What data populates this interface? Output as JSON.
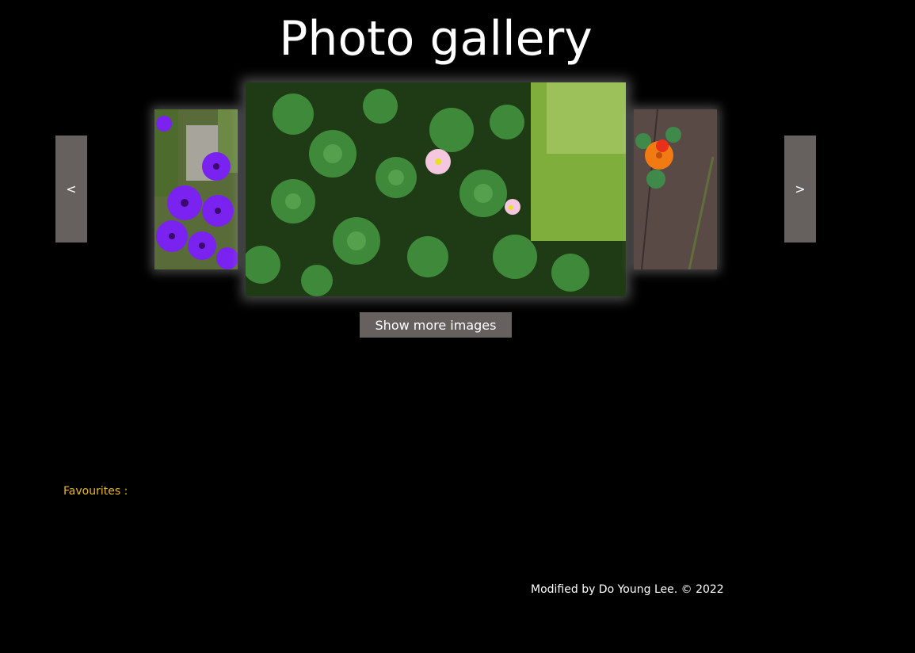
{
  "header": {
    "title": "Photo gallery"
  },
  "carousel": {
    "prev_label": "<",
    "next_label": ">",
    "photos": [
      {
        "position": "left",
        "subject": "purple-flowers"
      },
      {
        "position": "center",
        "subject": "clover-with-pink-flowers"
      },
      {
        "position": "right",
        "subject": "orange-flower-on-wood"
      }
    ]
  },
  "actions": {
    "show_more_label": "Show more images"
  },
  "favourites": {
    "label": "Favourites :"
  },
  "footer": {
    "credit": "Modified by Do Young Lee. © 2022"
  },
  "colors": {
    "background": "#000000",
    "button": "#66615f",
    "favourites": "#e8b829",
    "text": "#ffffff"
  }
}
